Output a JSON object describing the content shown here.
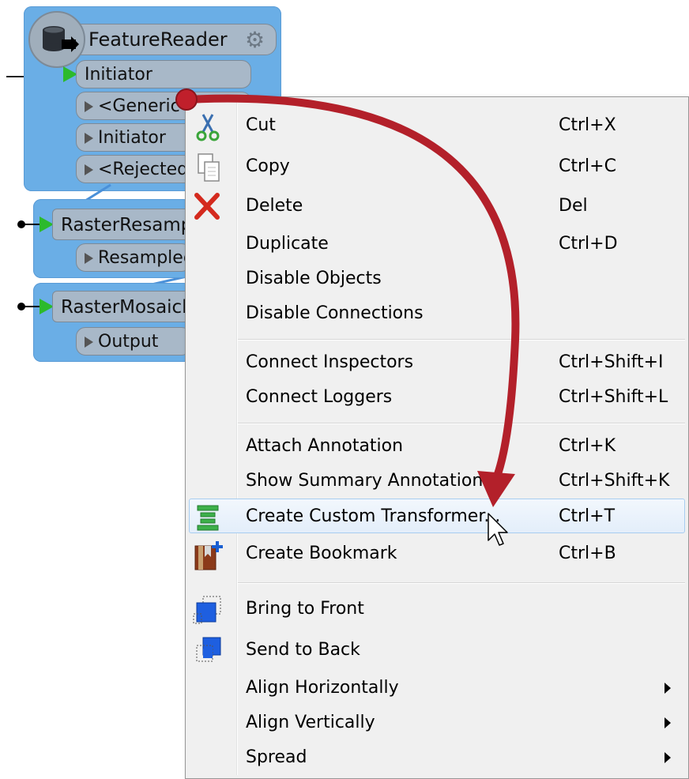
{
  "workspace": {
    "feature_reader": {
      "title": "FeatureReader",
      "input_port": "Initiator",
      "output_ports": [
        "<Generic",
        "Initiator",
        "<Rejected"
      ]
    },
    "raster_resampler": {
      "title": "RasterResamp",
      "output_port": "Resampled"
    },
    "raster_mosaicker": {
      "title": "RasterMosaick",
      "output_port": "Output"
    }
  },
  "menu": {
    "items": [
      {
        "label": "Cut",
        "shortcut": "Ctrl+X",
        "icon": "scissors-icon"
      },
      {
        "label": "Copy",
        "shortcut": "Ctrl+C",
        "icon": "copy-icon"
      },
      {
        "label": "Delete",
        "shortcut": "Del",
        "icon": "delete-x-icon"
      },
      {
        "label": "Duplicate",
        "shortcut": "Ctrl+D",
        "icon": ""
      },
      {
        "label": "Disable Objects",
        "shortcut": "",
        "icon": ""
      },
      {
        "label": "Disable Connections",
        "shortcut": "",
        "icon": ""
      },
      {
        "label": "Connect Inspectors",
        "shortcut": "Ctrl+Shift+I",
        "icon": ""
      },
      {
        "label": "Connect Loggers",
        "shortcut": "Ctrl+Shift+L",
        "icon": ""
      },
      {
        "label": "Attach Annotation",
        "shortcut": "Ctrl+K",
        "icon": ""
      },
      {
        "label": "Show Summary Annotations",
        "shortcut": "Ctrl+Shift+K",
        "icon": ""
      },
      {
        "label": "Create Custom Transformer...",
        "shortcut": "Ctrl+T",
        "icon": "custom-transformer-icon"
      },
      {
        "label": "Create Bookmark",
        "shortcut": "Ctrl+B",
        "icon": "bookmark-add-icon"
      },
      {
        "label": "Bring to Front",
        "shortcut": "",
        "icon": "bring-to-front-icon"
      },
      {
        "label": "Send to Back",
        "shortcut": "",
        "icon": "send-to-back-icon"
      },
      {
        "label": "Align Horizontally",
        "shortcut": "",
        "icon": ""
      },
      {
        "label": "Align Vertically",
        "shortcut": "",
        "icon": ""
      },
      {
        "label": "Spread",
        "shortcut": "",
        "icon": ""
      }
    ],
    "highlighted_item": "Create Custom Transformer..."
  },
  "colors": {
    "node_blue": "#6aaee6",
    "arrow_red": "#b3202a",
    "port_green": "#2cba2c",
    "menu_bg": "#f0f0f0",
    "highlight_border": "#a8cdf0"
  }
}
